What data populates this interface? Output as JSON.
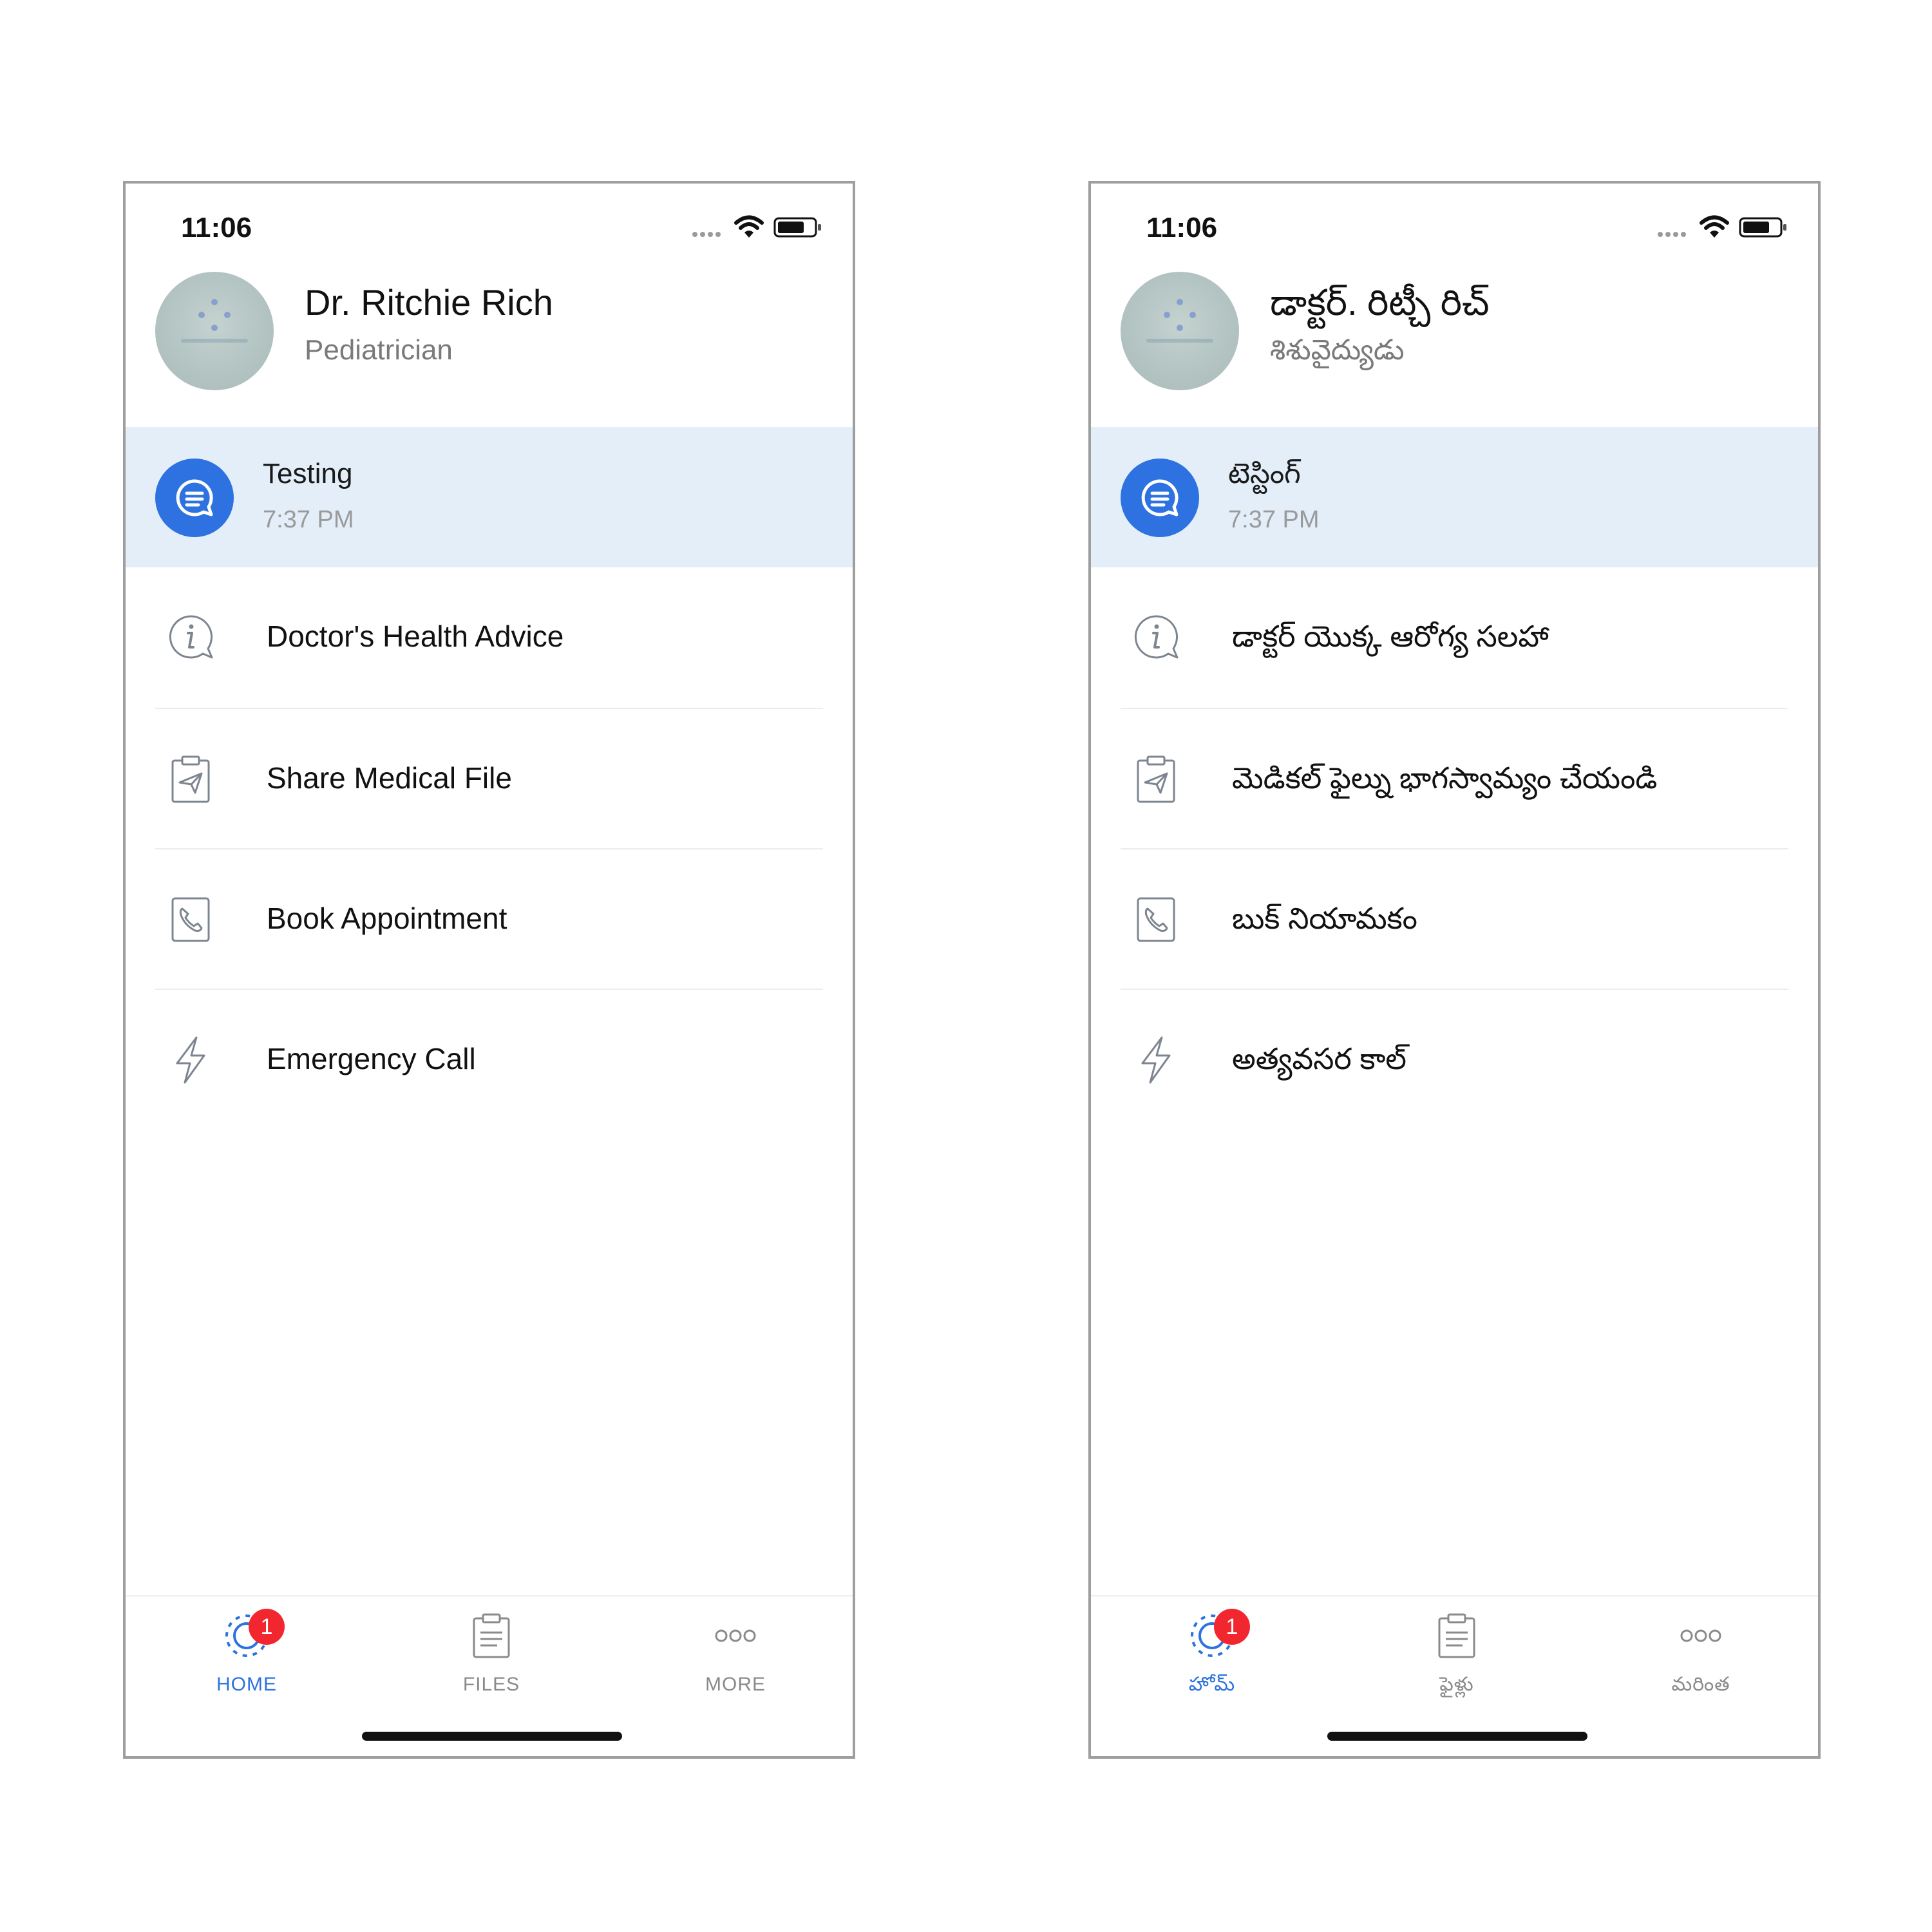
{
  "screens": [
    {
      "status": {
        "time": "11:06"
      },
      "profile": {
        "name": "Dr. Ritchie Rich",
        "specialty": "Pediatrician"
      },
      "chat": {
        "title": "Testing",
        "time": "7:37 PM"
      },
      "menu": [
        {
          "label": "Doctor's Health Advice",
          "icon": "info-chat-icon"
        },
        {
          "label": "Share Medical File",
          "icon": "clipboard-send-icon"
        },
        {
          "label": "Book Appointment",
          "icon": "phone-icon"
        },
        {
          "label": "Emergency Call",
          "icon": "lightning-icon"
        }
      ],
      "tabs": [
        {
          "label": "HOME",
          "icon": "home-icon",
          "badge": "1",
          "active": true
        },
        {
          "label": "FILES",
          "icon": "files-icon",
          "active": false
        },
        {
          "label": "MORE",
          "icon": "more-icon",
          "active": false
        }
      ]
    },
    {
      "status": {
        "time": "11:06"
      },
      "profile": {
        "name": "డాక్టర్. రిట్చీ రిచ్",
        "specialty": "శిశువైద్యుడు"
      },
      "chat": {
        "title": "టెస్టింగ్",
        "time": "7:37 PM"
      },
      "menu": [
        {
          "label": "డాక్టర్ యొక్క ఆరోగ్య సలహా",
          "icon": "info-chat-icon"
        },
        {
          "label": "మెడికల్ ఫైల్ను భాగస్వామ్యం చేయండి",
          "icon": "clipboard-send-icon"
        },
        {
          "label": "బుక్ నియామకం",
          "icon": "phone-icon"
        },
        {
          "label": "అత్యవసర కాల్",
          "icon": "lightning-icon"
        }
      ],
      "tabs": [
        {
          "label": "హోమ్",
          "icon": "home-icon",
          "badge": "1",
          "active": true
        },
        {
          "label": "ఫైళ్లు",
          "icon": "files-icon",
          "active": false
        },
        {
          "label": "మరింత",
          "icon": "more-icon",
          "active": false
        }
      ]
    }
  ],
  "colors": {
    "accent": "#2d72e0",
    "highlight_row": "#e3eef9",
    "badge": "#f2262e",
    "muted_text": "#7a7a7a",
    "icon_gray": "#7d8590"
  }
}
